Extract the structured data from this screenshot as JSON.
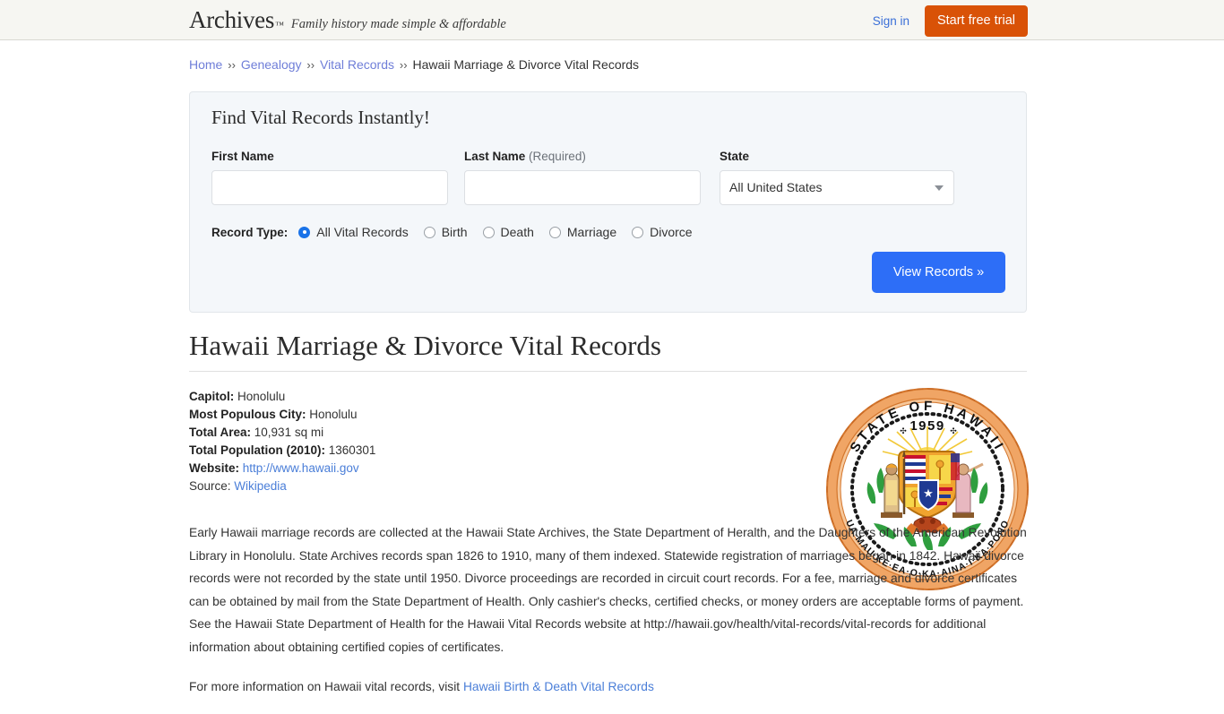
{
  "header": {
    "logo": "Archives",
    "logo_tm": "™",
    "tagline": "Family history made simple & affordable",
    "signin_label": "Sign in",
    "trial_label": "Start free trial",
    "bg_color": "#f6f6f2",
    "trial_color": "#d95207",
    "link_color": "#3a6fd8"
  },
  "breadcrumb": {
    "separator": "››",
    "items": [
      {
        "label": "Home",
        "link": true
      },
      {
        "label": "Genealogy",
        "link": true
      },
      {
        "label": "Vital Records",
        "link": true
      },
      {
        "label": "Hawaii Marriage & Divorce Vital Records",
        "link": false
      }
    ]
  },
  "search_panel": {
    "title": "Find Vital Records Instantly!",
    "first_name": {
      "label": "First Name",
      "value": "",
      "placeholder": ""
    },
    "last_name": {
      "label": "Last Name",
      "required_note": "(Required)",
      "value": "",
      "placeholder": ""
    },
    "state": {
      "label": "State",
      "selected": "All United States",
      "options": [
        "All United States"
      ]
    },
    "record_type": {
      "label": "Record Type:",
      "options": [
        {
          "label": "All Vital Records",
          "checked": true
        },
        {
          "label": "Birth",
          "checked": false
        },
        {
          "label": "Death",
          "checked": false
        },
        {
          "label": "Marriage",
          "checked": false
        },
        {
          "label": "Divorce",
          "checked": false
        }
      ]
    },
    "submit_label": "View Records »",
    "submit_color": "#2d6ef7",
    "bg_color": "#f4f7fa"
  },
  "page": {
    "title": "Hawaii Marriage & Divorce Vital Records"
  },
  "facts": [
    {
      "key": "Capitol:",
      "value": "Honolulu",
      "link": false
    },
    {
      "key": "Most Populous City:",
      "value": "Honolulu",
      "link": false
    },
    {
      "key": "Total Area:",
      "value": "10,931 sq mi",
      "link": false
    },
    {
      "key": "Total Population (2010):",
      "value": "1360301",
      "link": false
    },
    {
      "key": "Website:",
      "value": "http://www.hawaii.gov",
      "link": true
    }
  ],
  "source": {
    "label": "Source:",
    "link_text": "Wikipedia"
  },
  "seal": {
    "name": "hawaii-state-seal",
    "top_text": "STATE OF HAWAII",
    "year": "1959",
    "motto": "UA MAU KE EA O KA AINA I KA PONO",
    "ring_color": "#e8893a",
    "rim_color": "#f3a55e"
  },
  "body": {
    "paragraph_1": "Early Hawaii marriage records are collected at the Hawaii State Archives, the State Department of Heralth, and the Daughters of the American Revolution Library in Honolulu. State Archives records span 1826 to 1910, many of them indexed. Statewide registration of marriages began in 1842. Hawaii divorce records were not recorded by the state until 1950. Divorce proceedings are recorded in circuit court records. For a fee, marriage and divorce certificates can be obtained by mail from the State Department of Health. Only cashier's checks, certified checks, or money orders are acceptable forms of payment. See the Hawaii State Department of Health for the Hawaii Vital Records website at http://hawaii.gov/health/vital-records/vital-records for additional information about obtaining certified copies of certificates.",
    "paragraph_2_prefix": "For more information on Hawaii vital records, visit ",
    "paragraph_2_link": "Hawaii Birth & Death Vital Records"
  }
}
